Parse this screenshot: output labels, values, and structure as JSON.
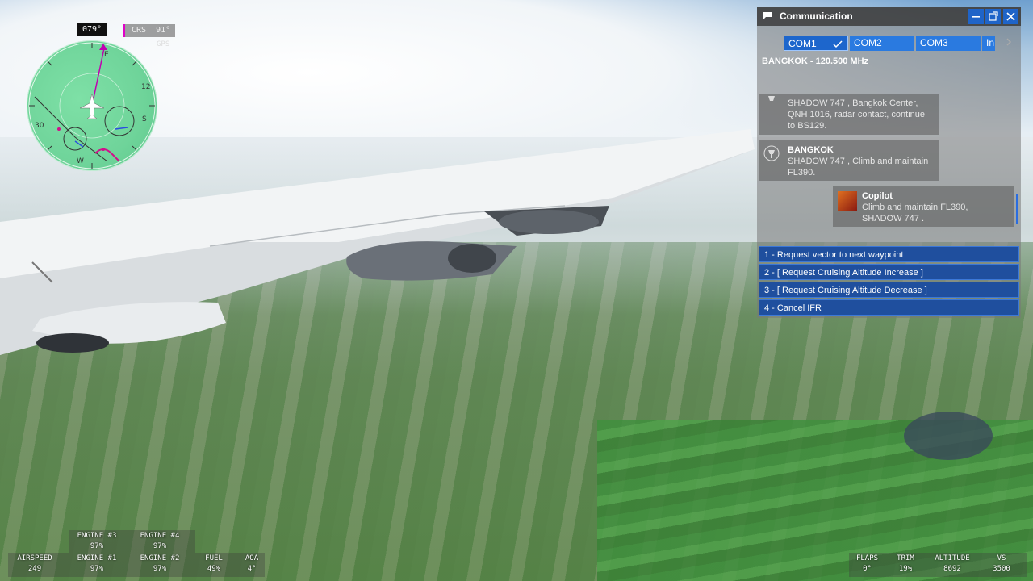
{
  "hud": {
    "heading": "079°",
    "crs_label": "CRS",
    "crs_value": "91°",
    "nav_source": "GPS"
  },
  "communication": {
    "title": "Communication",
    "tabs": [
      "COM1",
      "COM2",
      "COM3",
      "In"
    ],
    "active_tab": "COM1",
    "frequency": "BANGKOK - 120.500 MHz",
    "messages": [
      {
        "sender": "",
        "text": [
          "SHADOW 747 , Bangkok Center,",
          "QNH 1016, radar contact, continue",
          "to BS129."
        ]
      },
      {
        "sender": "BANGKOK",
        "text": [
          "SHADOW 747 , Climb and maintain",
          "FL390."
        ]
      },
      {
        "sender": "Copilot",
        "text": [
          "Climb and maintain FL390,",
          "SHADOW 747 ."
        ]
      }
    ],
    "options": [
      "1 - Request vector to next waypoint",
      "2 - [ Request Cruising Altitude Increase ]",
      "3 - [ Request Cruising Altitude Decrease ]",
      "4 - Cancel IFR"
    ]
  },
  "readouts": {
    "engine3_label": "ENGINE #3",
    "engine3_value": "97%",
    "engine4_label": "ENGINE #4",
    "engine4_value": "97%",
    "airspeed_label": "AIRSPEED",
    "airspeed_value": "249",
    "engine1_label": "ENGINE #1",
    "engine1_value": "97%",
    "engine2_label": "ENGINE #2",
    "engine2_value": "97%",
    "fuel_label": "FUEL",
    "fuel_value": "49%",
    "aoa_label": "AOA",
    "aoa_value": "4°",
    "flaps_label": "FLAPS",
    "flaps_value": "0°",
    "trim_label": "TRIM",
    "trim_value": "19%",
    "altitude_label": "ALTITUDE",
    "altitude_value": "8692",
    "vs_label": "VS",
    "vs_value": "3500"
  },
  "colors": {
    "accent_blue": "#1f64c8",
    "crs_magenta": "#e000c8",
    "map_green": "#6fd49a"
  }
}
